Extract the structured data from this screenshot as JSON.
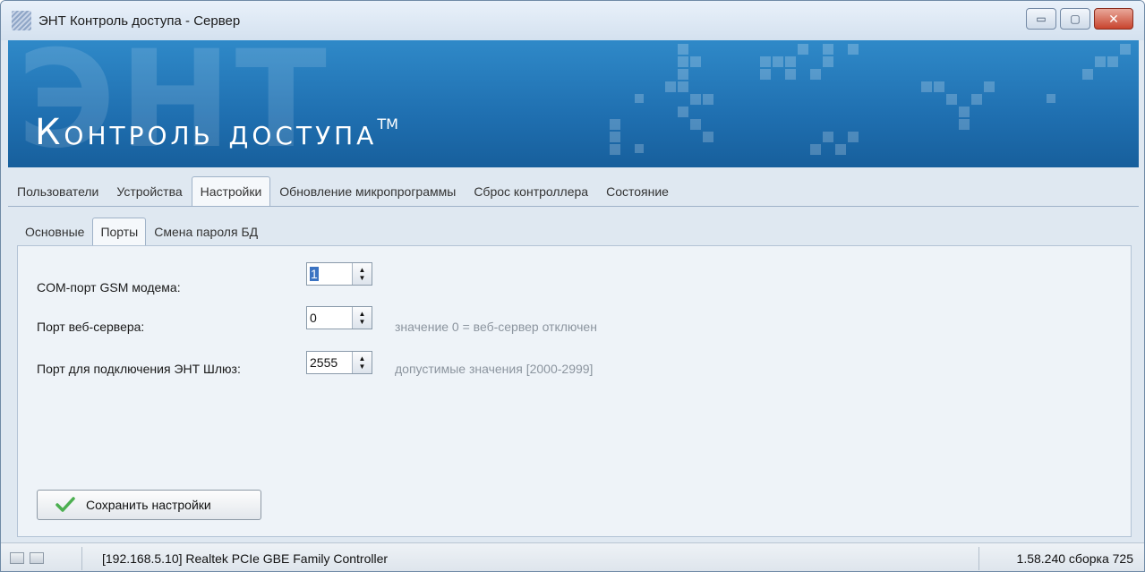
{
  "window": {
    "title": "ЭНТ Контроль доступа - Сервер",
    "controls": {
      "minimize": "▭",
      "maximize": "▢",
      "close": "✕"
    }
  },
  "banner": {
    "watermark": "ЭНТ",
    "title": "Контроль доступа",
    "trademark": "TM"
  },
  "tabs_main": [
    {
      "label": "Пользователи",
      "active": false
    },
    {
      "label": "Устройства",
      "active": false
    },
    {
      "label": "Настройки",
      "active": true
    },
    {
      "label": "Обновление микропрограммы",
      "active": false
    },
    {
      "label": "Сброс контроллера",
      "active": false
    },
    {
      "label": "Состояние",
      "active": false
    }
  ],
  "tabs_sub": [
    {
      "label": "Основные",
      "active": false
    },
    {
      "label": "Порты",
      "active": true
    },
    {
      "label": "Смена пароля БД",
      "active": false
    }
  ],
  "settings": {
    "gsm_label": "COM-порт GSM модема:",
    "gsm_value": "1",
    "web_label": "Порт веб-сервера:",
    "web_value": "0",
    "web_hint": "значение 0 = веб-сервер отключен",
    "gateway_label": "Порт для подключения ЭНТ Шлюз:",
    "gateway_value": "2555",
    "gateway_hint": "допустимые значения [2000-2999]"
  },
  "actions": {
    "save_label": "Сохранить настройки"
  },
  "statusbar": {
    "connection": "[192.168.5.10] Realtek PCIe GBE Family Controller",
    "version": "1.58.240 сборка 725"
  },
  "colors": {
    "banner": "#1f6fb0",
    "accent_check": "#4caf50",
    "close_button": "#c8442e"
  }
}
